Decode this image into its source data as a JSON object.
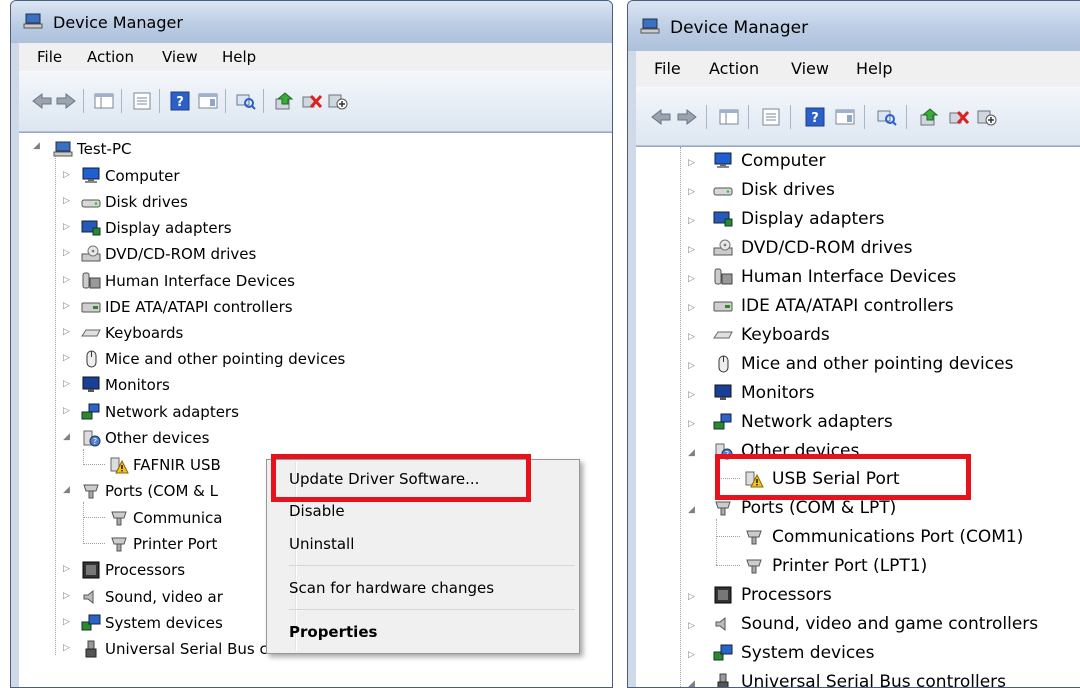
{
  "left": {
    "title": "Device Manager",
    "menu": [
      "File",
      "Action",
      "View",
      "Help"
    ],
    "root": "Test-PC",
    "nodes": {
      "computer": "Computer",
      "disk": "Disk drives",
      "display": "Display adapters",
      "dvd": "DVD/CD-ROM drives",
      "hid": "Human Interface Devices",
      "ide": "IDE ATA/ATAPI controllers",
      "keyboards": "Keyboards",
      "mice": "Mice and other pointing devices",
      "monitors": "Monitors",
      "network": "Network adapters",
      "other": "Other devices",
      "fafnir": "FAFNIR USB",
      "ports": "Ports (COM & L",
      "comm": "Communica",
      "printer": "Printer Port",
      "processors": "Processors",
      "sound": "Sound, video ar",
      "system": "System devices",
      "usb": "Universal Serial Bus controllers"
    },
    "context_menu": {
      "update": "Update Driver Software...",
      "disable": "Disable",
      "uninstall": "Uninstall",
      "scan": "Scan for hardware changes",
      "properties": "Properties"
    }
  },
  "right": {
    "title": "Device Manager",
    "menu": [
      "File",
      "Action",
      "View",
      "Help"
    ],
    "nodes": {
      "computer": "Computer",
      "disk": "Disk drives",
      "display": "Display adapters",
      "dvd": "DVD/CD-ROM drives",
      "hid": "Human Interface Devices",
      "ide": "IDE ATA/ATAPI controllers",
      "keyboards": "Keyboards",
      "mice": "Mice and other pointing devices",
      "monitors": "Monitors",
      "network": "Network adapters",
      "other": "Other devices",
      "usbserial": "USB Serial Port",
      "ports": "Ports (COM & LPT)",
      "comm": "Communications Port (COM1)",
      "printer": "Printer Port (LPT1)",
      "processors": "Processors",
      "sound": "Sound, video and game controllers",
      "system": "System devices",
      "usb": "Universal Serial Bus controllers"
    }
  },
  "colors": {
    "highlight": "#e8121c",
    "titlebar": "#bccde4"
  }
}
